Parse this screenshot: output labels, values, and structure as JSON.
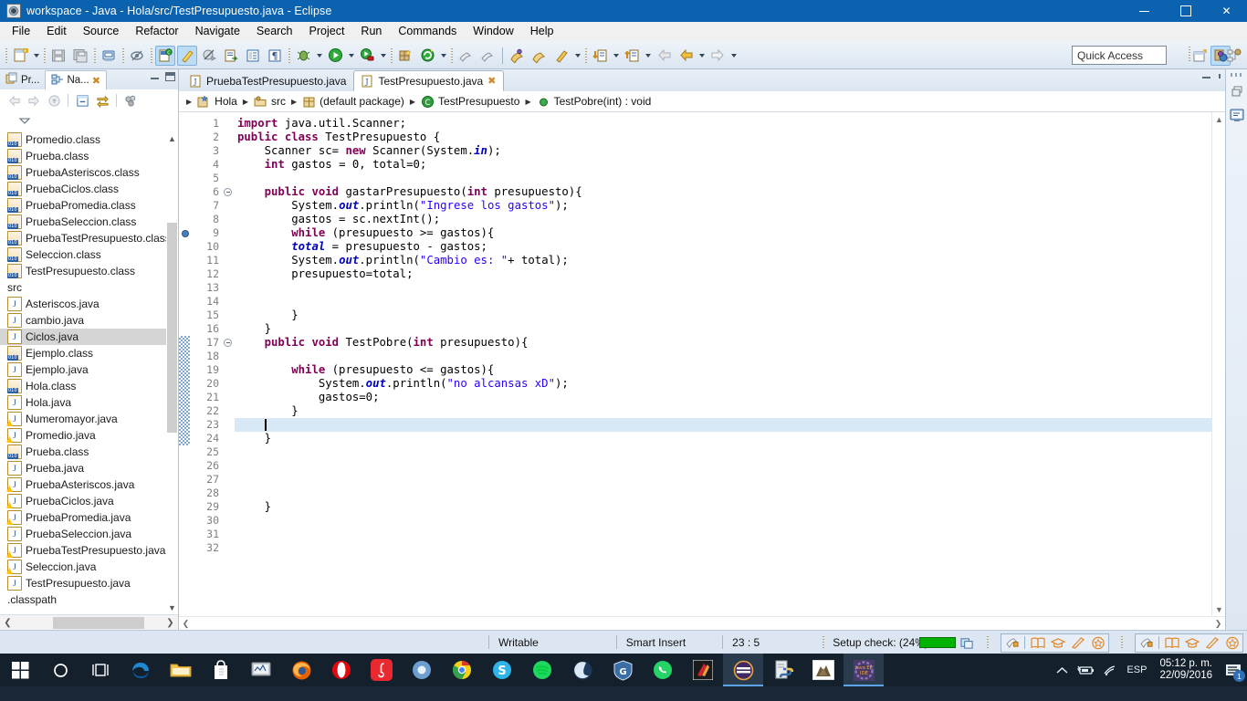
{
  "window": {
    "title": "workspace - Java - Hola/src/TestPresupuesto.java - Eclipse",
    "app_icon": "eclipse-icon",
    "minimize": "−",
    "maximize": "□",
    "close": "✕"
  },
  "menubar": {
    "items": [
      "File",
      "Edit",
      "Source",
      "Refactor",
      "Navigate",
      "Search",
      "Project",
      "Run",
      "Commands",
      "Window",
      "Help"
    ]
  },
  "toolbar": {
    "quick_access_placeholder": "Quick Access",
    "icons": [
      "new-wizard-icon",
      "save-icon",
      "save-all-icon",
      "print-icon",
      "toggle-mark-occurrences-icon",
      "new-java-class-icon",
      "new-annotation-icon",
      "skip-breakpoints-icon",
      "open-type-icon",
      "open-task-icon",
      "show-whitespace-icon",
      "debug-icon",
      "run-icon",
      "run-external-tools-icon",
      "new-java-project-icon",
      "refresh-icon",
      "open-perspective-icon",
      "search-icon",
      "open-resource-icon",
      "open-folder-icon",
      "pencil-icon",
      "next-annotation-icon",
      "previous-annotation-icon",
      "back-icon",
      "forward-icon",
      "next-edit-icon"
    ],
    "right_icons": [
      "open-perspective-icon",
      "java-perspective-icon",
      "java-browsing-icon"
    ]
  },
  "explorer": {
    "tabs": [
      {
        "label": "Pr...",
        "icon": "package-explorer-icon",
        "active": false
      },
      {
        "label": "Na...",
        "icon": "navigator-icon",
        "active": true,
        "closable": true
      }
    ],
    "view_buttons": [
      "minimize-view-icon",
      "maximize-view-icon"
    ],
    "toolbar_icons": [
      "back-icon",
      "forward-icon",
      "up-icon",
      "collapse-all-icon",
      "link-with-editor-icon",
      "view-menu-icon"
    ],
    "menu_icon": "view-menu-chevron-icon",
    "tree": [
      {
        "label": "Promedio.class",
        "icon": "class-file-icon",
        "selected": false
      },
      {
        "label": "Prueba.class",
        "icon": "class-file-icon",
        "selected": false
      },
      {
        "label": "PruebaAsteriscos.class",
        "icon": "class-file-icon",
        "selected": false
      },
      {
        "label": "PruebaCiclos.class",
        "icon": "class-file-icon",
        "selected": false
      },
      {
        "label": "PruebaPromedia.class",
        "icon": "class-file-icon",
        "selected": false
      },
      {
        "label": "PruebaSeleccion.class",
        "icon": "class-file-icon",
        "selected": false
      },
      {
        "label": "PruebaTestPresupuesto.class",
        "icon": "class-file-icon",
        "selected": false
      },
      {
        "label": "Seleccion.class",
        "icon": "class-file-icon",
        "selected": false
      },
      {
        "label": "TestPresupuesto.class",
        "icon": "class-file-icon",
        "selected": false
      },
      {
        "label": "src",
        "icon": "none",
        "selected": false
      },
      {
        "label": "Asteriscos.java",
        "icon": "java-file-icon",
        "selected": false
      },
      {
        "label": "cambio.java",
        "icon": "java-file-icon",
        "selected": false
      },
      {
        "label": "Ciclos.java",
        "icon": "java-file-icon",
        "selected": true
      },
      {
        "label": "Ejemplo.class",
        "icon": "class-file-icon",
        "selected": false
      },
      {
        "label": "Ejemplo.java",
        "icon": "java-file-icon",
        "selected": false
      },
      {
        "label": "Hola.class",
        "icon": "class-file-icon",
        "selected": false
      },
      {
        "label": "Hola.java",
        "icon": "java-file-icon",
        "selected": false
      },
      {
        "label": "Numeromayor.java",
        "icon": "java-file-warning-icon",
        "selected": false
      },
      {
        "label": "Promedio.java",
        "icon": "java-file-warning-icon",
        "selected": false
      },
      {
        "label": "Prueba.class",
        "icon": "class-file-icon",
        "selected": false
      },
      {
        "label": "Prueba.java",
        "icon": "java-file-icon",
        "selected": false
      },
      {
        "label": "PruebaAsteriscos.java",
        "icon": "java-file-warning-icon",
        "selected": false
      },
      {
        "label": "PruebaCiclos.java",
        "icon": "java-file-warning-icon",
        "selected": false
      },
      {
        "label": "PruebaPromedia.java",
        "icon": "java-file-warning-icon",
        "selected": false
      },
      {
        "label": "PruebaSeleccion.java",
        "icon": "java-file-icon",
        "selected": false
      },
      {
        "label": "PruebaTestPresupuesto.java",
        "icon": "java-file-warning-icon",
        "selected": false
      },
      {
        "label": "Seleccion.java",
        "icon": "java-file-warning-icon",
        "selected": false
      },
      {
        "label": "TestPresupuesto.java",
        "icon": "java-file-icon",
        "selected": false
      },
      {
        "label": ".classpath",
        "icon": "none",
        "selected": false
      }
    ],
    "scroll_up": "▲",
    "scroll_down": "▼",
    "scroll_left": "❮",
    "scroll_right": "❯"
  },
  "editor": {
    "tabs": [
      {
        "label": "PruebaTestPresupuesto.java",
        "icon": "java-file-icon",
        "active": false,
        "closable": false
      },
      {
        "label": "TestPresupuesto.java",
        "icon": "java-file-icon",
        "active": true,
        "closable": true,
        "close_glyph": "✖"
      }
    ],
    "view_buttons": [
      "minimize-editor-icon",
      "maximize-editor-icon"
    ],
    "breadcrumb": [
      {
        "label": "Hola",
        "icon": "java-project-icon"
      },
      {
        "label": "src",
        "icon": "source-folder-icon"
      },
      {
        "label": "(default package)",
        "icon": "package-icon"
      },
      {
        "label": "TestPresupuesto",
        "icon": "class-icon"
      },
      {
        "label": "TestPobre(int) : void",
        "icon": "method-icon"
      }
    ],
    "breadcrumb_separator": "▶",
    "current_line": 23,
    "breakpoint_line": 9,
    "fold_lines": [
      6,
      17
    ],
    "changed_lines": [
      17,
      18,
      19,
      20,
      21,
      22,
      23,
      24
    ],
    "lines": [
      {
        "n": 1,
        "tokens": [
          {
            "t": "import ",
            "c": "kw"
          },
          {
            "t": "java.util.Scanner;",
            "c": ""
          }
        ]
      },
      {
        "n": 2,
        "tokens": [
          {
            "t": "public class ",
            "c": "kw"
          },
          {
            "t": "TestPresupuesto {",
            "c": ""
          }
        ]
      },
      {
        "n": 3,
        "tokens": [
          {
            "t": "    Scanner sc= ",
            "c": ""
          },
          {
            "t": "new ",
            "c": "kw"
          },
          {
            "t": "Scanner(System.",
            "c": ""
          },
          {
            "t": "in",
            "c": "fld"
          },
          {
            "t": ");",
            "c": ""
          }
        ]
      },
      {
        "n": 4,
        "tokens": [
          {
            "t": "    ",
            "c": ""
          },
          {
            "t": "int ",
            "c": "kw"
          },
          {
            "t": "gastos = 0, total=0;",
            "c": ""
          }
        ]
      },
      {
        "n": 5,
        "tokens": []
      },
      {
        "n": 6,
        "tokens": [
          {
            "t": "    ",
            "c": ""
          },
          {
            "t": "public void ",
            "c": "kw"
          },
          {
            "t": "gastarPresupuesto(",
            "c": ""
          },
          {
            "t": "int ",
            "c": "kw"
          },
          {
            "t": "presupuesto){",
            "c": ""
          }
        ]
      },
      {
        "n": 7,
        "tokens": [
          {
            "t": "        System.",
            "c": ""
          },
          {
            "t": "out",
            "c": "fld"
          },
          {
            "t": ".println(",
            "c": ""
          },
          {
            "t": "\"Ingrese los gastos\"",
            "c": "str"
          },
          {
            "t": ");",
            "c": ""
          }
        ]
      },
      {
        "n": 8,
        "tokens": [
          {
            "t": "        gastos = sc.nextInt();",
            "c": ""
          }
        ]
      },
      {
        "n": 9,
        "tokens": [
          {
            "t": "        ",
            "c": ""
          },
          {
            "t": "while ",
            "c": "kw"
          },
          {
            "t": "(presupuesto >= gastos){",
            "c": ""
          }
        ]
      },
      {
        "n": 10,
        "tokens": [
          {
            "t": "        ",
            "c": ""
          },
          {
            "t": "total",
            "c": "fld"
          },
          {
            "t": " = presupuesto - gastos;",
            "c": ""
          }
        ]
      },
      {
        "n": 11,
        "tokens": [
          {
            "t": "        System.",
            "c": ""
          },
          {
            "t": "out",
            "c": "fld"
          },
          {
            "t": ".println(",
            "c": ""
          },
          {
            "t": "\"Cambio es: \"",
            "c": "str"
          },
          {
            "t": "+ total);",
            "c": ""
          }
        ]
      },
      {
        "n": 12,
        "tokens": [
          {
            "t": "        presupuesto=total;",
            "c": ""
          }
        ]
      },
      {
        "n": 13,
        "tokens": []
      },
      {
        "n": 14,
        "tokens": []
      },
      {
        "n": 15,
        "tokens": [
          {
            "t": "        }",
            "c": ""
          }
        ]
      },
      {
        "n": 16,
        "tokens": [
          {
            "t": "    }",
            "c": ""
          }
        ]
      },
      {
        "n": 17,
        "tokens": [
          {
            "t": "    ",
            "c": ""
          },
          {
            "t": "public void ",
            "c": "kw"
          },
          {
            "t": "TestPobre(",
            "c": ""
          },
          {
            "t": "int ",
            "c": "kw"
          },
          {
            "t": "presupuesto){",
            "c": ""
          }
        ]
      },
      {
        "n": 18,
        "tokens": []
      },
      {
        "n": 19,
        "tokens": [
          {
            "t": "        ",
            "c": ""
          },
          {
            "t": "while ",
            "c": "kw"
          },
          {
            "t": "(presupuesto <= gastos){",
            "c": ""
          }
        ]
      },
      {
        "n": 20,
        "tokens": [
          {
            "t": "            System.",
            "c": ""
          },
          {
            "t": "out",
            "c": "fld"
          },
          {
            "t": ".println(",
            "c": ""
          },
          {
            "t": "\"no alcansas xD\"",
            "c": "str"
          },
          {
            "t": ");",
            "c": ""
          }
        ]
      },
      {
        "n": 21,
        "tokens": [
          {
            "t": "            gastos=0;",
            "c": ""
          }
        ]
      },
      {
        "n": 22,
        "tokens": [
          {
            "t": "        }",
            "c": ""
          }
        ]
      },
      {
        "n": 23,
        "tokens": []
      },
      {
        "n": 24,
        "tokens": [
          {
            "t": "    }",
            "c": ""
          }
        ]
      },
      {
        "n": 25,
        "tokens": []
      },
      {
        "n": 26,
        "tokens": []
      },
      {
        "n": 27,
        "tokens": []
      },
      {
        "n": 28,
        "tokens": []
      },
      {
        "n": 29,
        "tokens": [
          {
            "t": "    }",
            "c": ""
          }
        ]
      },
      {
        "n": 30,
        "tokens": []
      },
      {
        "n": 31,
        "tokens": []
      },
      {
        "n": 32,
        "tokens": []
      }
    ]
  },
  "right_rail": {
    "icons": [
      "restore-icon",
      "java-editor-icon"
    ]
  },
  "statusbar": {
    "writable": "Writable",
    "insert_mode": "Smart Insert",
    "cursor_position": "23 : 5",
    "progress_text": "Setup check: (24%)",
    "progress_value": 24,
    "progress_color": "#00b200",
    "right_icons": [
      "progress-bar",
      "show-progress-icon",
      "lock-icon",
      "book-icon",
      "graduation-icon",
      "pencil-icon",
      "badge-icon"
    ]
  },
  "taskbar": {
    "items": [
      {
        "name": "start-button",
        "icon": "windows-logo-icon"
      },
      {
        "name": "cortana-button",
        "icon": "circle-icon"
      },
      {
        "name": "task-view-button",
        "icon": "task-view-icon"
      },
      {
        "name": "edge",
        "icon": "edge-icon"
      },
      {
        "name": "file-explorer",
        "icon": "folder-icon"
      },
      {
        "name": "store",
        "icon": "store-icon"
      },
      {
        "name": "monitor-app",
        "icon": "monitor-icon"
      },
      {
        "name": "firefox",
        "icon": "firefox-icon"
      },
      {
        "name": "opera",
        "icon": "opera-icon"
      },
      {
        "name": "netease-music",
        "icon": "netease-icon"
      },
      {
        "name": "chromium",
        "icon": "chromium-icon"
      },
      {
        "name": "chrome",
        "icon": "chrome-icon"
      },
      {
        "name": "skype",
        "icon": "skype-icon"
      },
      {
        "name": "spotify",
        "icon": "spotify-icon"
      },
      {
        "name": "moon-app",
        "icon": "moon-icon"
      },
      {
        "name": "antivirus",
        "icon": "shield-icon"
      },
      {
        "name": "whatsapp",
        "icon": "whatsapp-icon"
      },
      {
        "name": "game-app",
        "icon": "game-icon"
      },
      {
        "name": "eclipse",
        "icon": "eclipse-icon",
        "active": true
      },
      {
        "name": "python",
        "icon": "python-icon"
      },
      {
        "name": "image-viewer",
        "icon": "picture-icon"
      },
      {
        "name": "java-ee-ide",
        "icon": "java-ee-icon",
        "active": true
      }
    ],
    "tray": {
      "chevron": "︿",
      "battery_icon": "battery-icon",
      "network_icon": "wifi-icon",
      "language": "ESP",
      "time": "05:12 p. m.",
      "date": "22/09/2016",
      "notifications_count": "1"
    }
  }
}
